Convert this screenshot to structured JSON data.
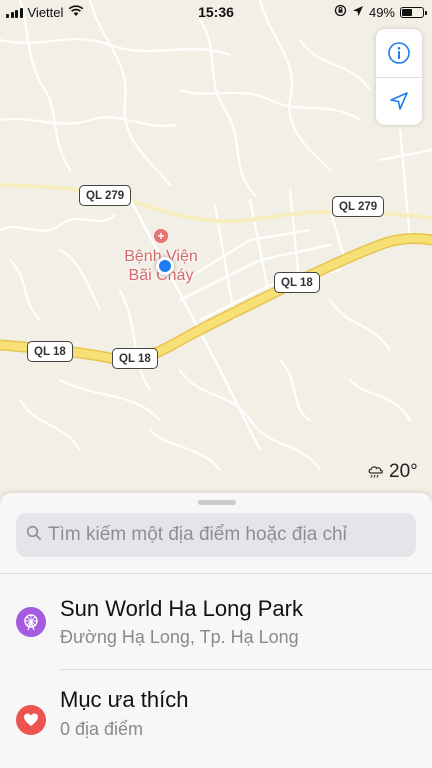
{
  "status_bar": {
    "carrier": "Viettel",
    "time": "15:36",
    "battery_percent": "49%",
    "battery_level": 0.49,
    "icons": [
      "signal-icon",
      "wifi-icon",
      "orientation-lock-icon",
      "location-arrow-icon",
      "battery-icon"
    ]
  },
  "map": {
    "road_labels": [
      "QL 279",
      "QL 279",
      "QL 18",
      "QL 18",
      "QL 18"
    ],
    "poi": {
      "name_line1": "Bệnh Viện",
      "name_line2": "Bãi Cháy",
      "icon": "hospital-icon",
      "color": "#d46a6a"
    },
    "user_location_color": "#1e7cf2",
    "highway_color": "#f4d96b",
    "controls": {
      "info_icon": "info-icon",
      "tracking_icon": "location-arrow-icon",
      "accent": "#1e7cf2"
    },
    "weather": {
      "icon": "rain-cloud-icon",
      "temperature": "20°"
    }
  },
  "sheet": {
    "search": {
      "placeholder": "Tìm kiếm một địa điểm hoặc địa chỉ",
      "value": "",
      "icon": "search-icon"
    },
    "items": [
      {
        "title": "Sun World Ha Long Park",
        "subtitle": "Đường Hạ Long, Tp. Hạ Long",
        "icon": "ferris-wheel-icon",
        "icon_color": "#a45be0"
      },
      {
        "title": "Mục ưa thích",
        "subtitle": "0 địa điểm",
        "icon": "heart-icon",
        "icon_color": "#ef5350"
      }
    ]
  }
}
